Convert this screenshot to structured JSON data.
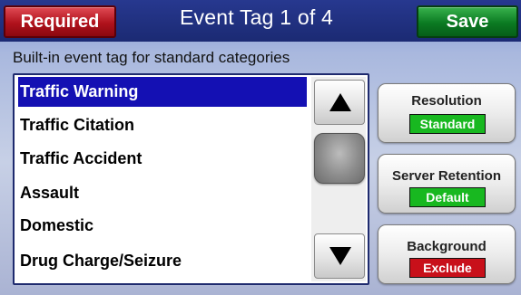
{
  "header": {
    "required_label": "Required",
    "title": "Event Tag 1 of 4",
    "save_label": "Save"
  },
  "subtitle": "Built-in event tag for standard categories",
  "list": {
    "items": [
      {
        "label": "Traffic Warning",
        "selected": true
      },
      {
        "label": "Traffic Citation",
        "selected": false
      },
      {
        "label": "Traffic Accident",
        "selected": false
      },
      {
        "label": "Assault",
        "selected": false
      },
      {
        "label": "Domestic",
        "selected": false
      },
      {
        "label": "Drug Charge/Seizure",
        "selected": false
      }
    ],
    "scroll_up_icon": "up-triangle-icon",
    "scroll_down_icon": "down-triangle-icon"
  },
  "settings": {
    "resolution": {
      "label": "Resolution",
      "value": "Standard",
      "color": "#18b820"
    },
    "server_retention": {
      "label": "Server Retention",
      "value": "Default",
      "color": "#18b820"
    },
    "background": {
      "label": "Background",
      "value": "Exclude",
      "color": "#c8101a"
    }
  },
  "colors": {
    "selected_row": "#1410b3",
    "required_red": "#b0121c",
    "save_green": "#0b7a22"
  }
}
